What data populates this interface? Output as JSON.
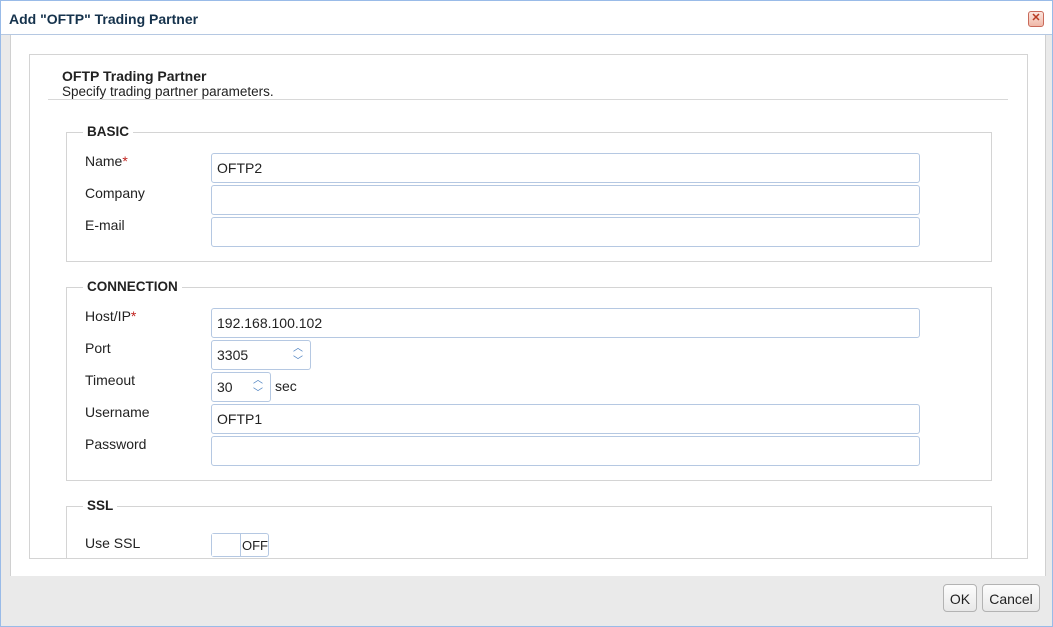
{
  "dialog": {
    "title": "Add \"OFTP\" Trading Partner",
    "close_glyph": "✕"
  },
  "panel": {
    "title": "OFTP Trading Partner",
    "subtitle": "Specify trading partner parameters."
  },
  "basic": {
    "legend": "BASIC",
    "name_label": "Name",
    "name_value": "OFTP2",
    "company_label": "Company",
    "company_value": "",
    "email_label": "E-mail",
    "email_value": ""
  },
  "connection": {
    "legend": "CONNECTION",
    "host_label": "Host/IP",
    "host_value": "192.168.100.102",
    "port_label": "Port",
    "port_value": "3305",
    "timeout_label": "Timeout",
    "timeout_value": "30",
    "timeout_unit": "sec",
    "username_label": "Username",
    "username_value": "OFTP1",
    "password_label": "Password",
    "password_value": ""
  },
  "ssl": {
    "legend": "SSL",
    "use_ssl_label": "Use SSL",
    "use_ssl_state": "OFF"
  },
  "required_marker": "*",
  "footer": {
    "ok_label": "OK",
    "cancel_label": "Cancel"
  },
  "colors": {
    "accent": "#99bbe8",
    "title_text": "#15324c",
    "required": "#c0231f"
  }
}
